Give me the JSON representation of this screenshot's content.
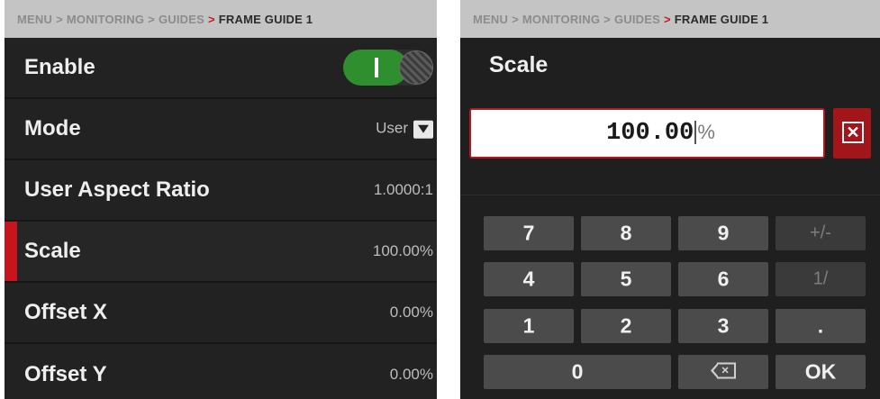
{
  "left": {
    "breadcrumb": {
      "path": [
        "MENU",
        "MONITORING",
        "GUIDES"
      ],
      "separator": ">",
      "current": "FRAME GUIDE 1"
    },
    "rows": [
      {
        "label": "Enable",
        "control": "toggle",
        "toggle_on": true
      },
      {
        "label": "Mode",
        "value": "User",
        "control": "dropdown"
      },
      {
        "label": "User Aspect Ratio",
        "value": "1.0000:1"
      },
      {
        "label": "Scale",
        "value": "100.00%",
        "selected": true
      },
      {
        "label": "Offset X",
        "value": "0.00%"
      },
      {
        "label": "Offset Y",
        "value": "0.00%"
      }
    ]
  },
  "right": {
    "breadcrumb": {
      "path": [
        "MENU",
        "MONITORING",
        "GUIDES"
      ],
      "separator": ">",
      "current": "FRAME GUIDE 1"
    },
    "title": "Scale",
    "input": {
      "value": "100.00",
      "unit": "%"
    },
    "clear_icon": "close-box-icon",
    "keypad": {
      "row1": [
        "7",
        "8",
        "9",
        "+/-"
      ],
      "row2": [
        "4",
        "5",
        "6",
        "1/"
      ],
      "row3": [
        "1",
        "2",
        "3",
        "."
      ],
      "zero": "0",
      "backspace_icon": "backspace-icon",
      "ok": "OK"
    }
  },
  "colors": {
    "accent_red": "#c8151d",
    "toggle_green": "#2f8f2f",
    "panel_bg": "#1f1f1f",
    "key_bg": "#4b4b4b"
  }
}
